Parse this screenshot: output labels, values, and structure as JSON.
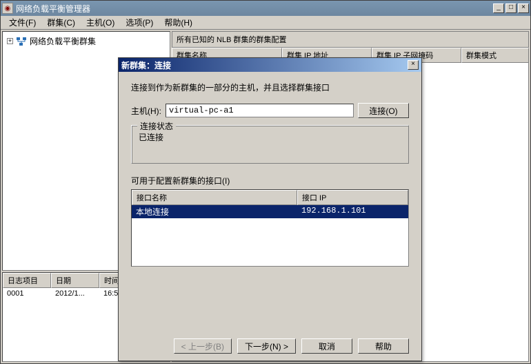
{
  "app": {
    "title": "网络负载平衡管理器",
    "icon_glyph": "◉"
  },
  "menu": {
    "file": "文件(F)",
    "cluster": "群集(C)",
    "host": "主机(O)",
    "options": "选项(P)",
    "help": "帮助(H)"
  },
  "tree": {
    "root_label": "网络负载平衡群集",
    "expand_glyph": "+"
  },
  "log": {
    "cols": {
      "entry": "日志项目",
      "date": "日期",
      "time": "时间"
    },
    "rows": [
      {
        "entry": "0001",
        "date": "2012/1...",
        "time": "16:5"
      }
    ]
  },
  "right": {
    "header": "所有已知的 NLB 群集的群集配置",
    "cols": {
      "name": "群集名称",
      "ip": "群集 IP 地址",
      "mask": "群集 IP 子网掩码",
      "mode": "群集模式"
    }
  },
  "dialog": {
    "title": "新群集：连接",
    "instruction": "连接到作为新群集的一部分的主机，并且选择群集接口",
    "host_label": "主机(H):",
    "host_value": "virtual-pc-a1",
    "connect_btn": "连接(O)",
    "status_group_label": "连接状态",
    "status_text": "已连接",
    "iface_label": "可用于配置新群集的接口(I)",
    "iface_cols": {
      "name": "接口名称",
      "ip": "接口 IP"
    },
    "iface_rows": [
      {
        "name": "本地连接",
        "ip": "192.168.1.101"
      }
    ],
    "buttons": {
      "back": "< 上一步(B)",
      "next": "下一步(N) >",
      "cancel": "取消",
      "help": "帮助"
    }
  }
}
